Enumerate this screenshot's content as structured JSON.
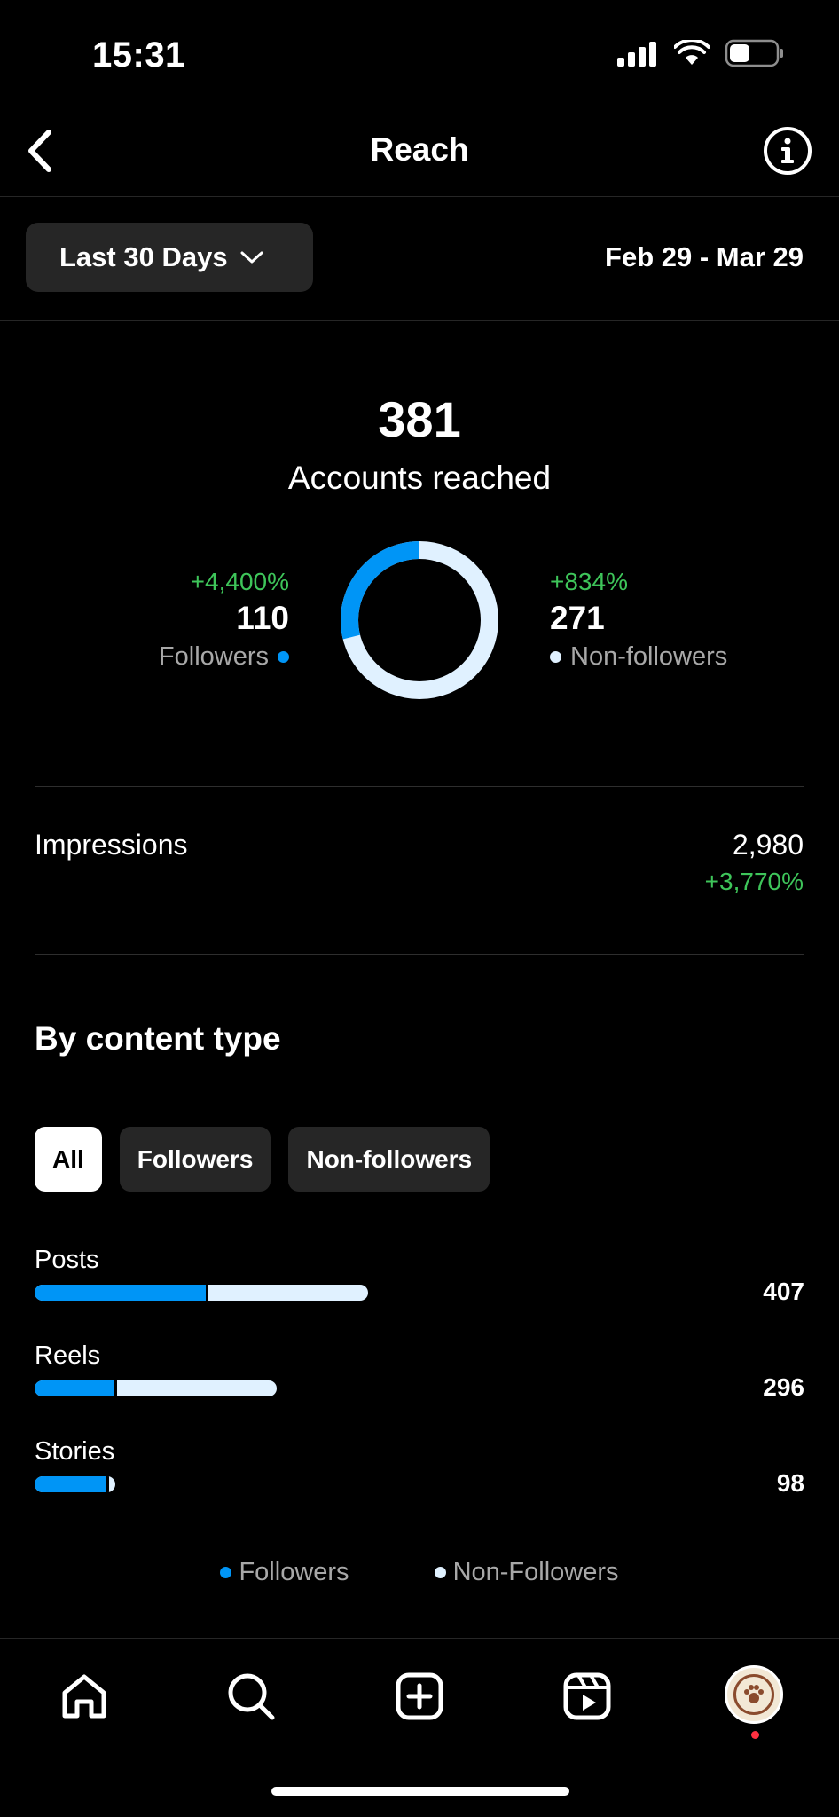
{
  "status_bar": {
    "time": "15:31",
    "battery_level": 0.4
  },
  "nav": {
    "title": "Reach",
    "back_icon": "chevron-left-icon",
    "info_icon": "info-icon"
  },
  "filter": {
    "range_label": "Last 30 Days",
    "date_range": "Feb 29 - Mar 29"
  },
  "summary": {
    "accounts_reached": "381",
    "accounts_reached_label": "Accounts reached"
  },
  "breakdown": {
    "followers": {
      "change": "+4,400%",
      "value": "110",
      "label": "Followers",
      "color": "#0095f6"
    },
    "non_followers": {
      "change": "+834%",
      "value": "271",
      "label": "Non-followers",
      "color": "#e0f1ff"
    }
  },
  "impressions": {
    "label": "Impressions",
    "value": "2,980",
    "change": "+3,770%"
  },
  "content_type": {
    "title": "By content type",
    "pills": [
      {
        "label": "All",
        "active": true
      },
      {
        "label": "Followers",
        "active": false
      },
      {
        "label": "Non-followers",
        "active": false
      }
    ]
  },
  "chart_data": {
    "type": "bar",
    "categories": [
      "Posts",
      "Reels",
      "Stories"
    ],
    "totals_labels": [
      "407",
      "296",
      "98"
    ],
    "series": [
      {
        "name": "Followers",
        "values": [
          210,
          100,
          90
        ],
        "color": "#0095f6"
      },
      {
        "name": "Non-Followers",
        "values": [
          197,
          196,
          8
        ],
        "color": "#e0f1ff"
      }
    ],
    "legend": [
      "Followers",
      "Non-Followers"
    ],
    "legend_position": "bottom"
  },
  "tab_bar": {
    "items": [
      "home-icon",
      "search-icon",
      "create-icon",
      "reels-icon",
      "profile-avatar"
    ]
  }
}
